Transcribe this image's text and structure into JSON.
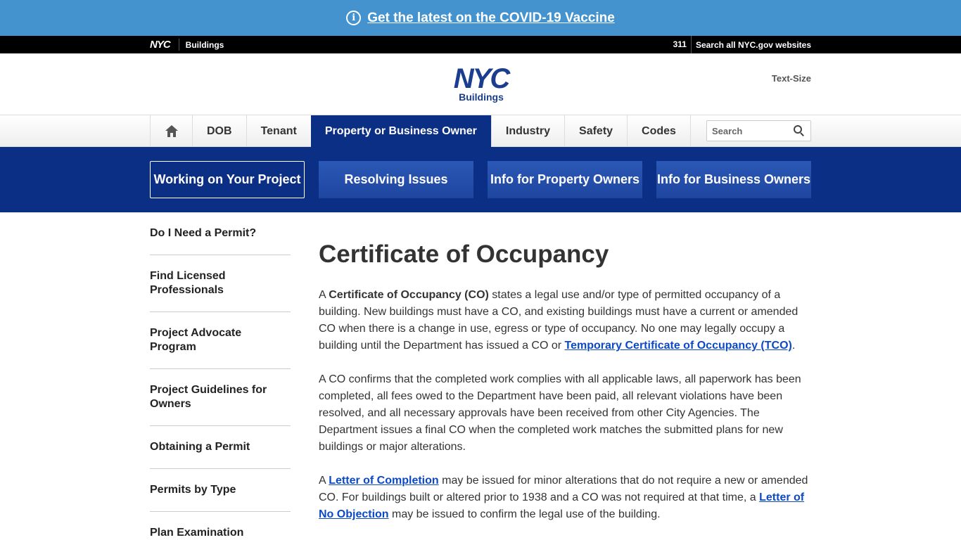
{
  "covid_banner": {
    "icon": "info-icon",
    "link_text": "Get the latest on the COVID-19 Vaccine"
  },
  "city_bar": {
    "logo": "NYC",
    "agency": "Buildings",
    "link_311": "311",
    "search_all": "Search all NYC.gov websites"
  },
  "header": {
    "logo_main": "NYC",
    "logo_sub": "Buildings",
    "text_size": "Text-Size"
  },
  "nav": {
    "items": [
      "DOB",
      "Tenant",
      "Property or Business Owner",
      "Industry",
      "Safety",
      "Codes"
    ],
    "active": "Property or Business Owner",
    "search_placeholder": "Search"
  },
  "subnav": {
    "buttons": [
      "Working on Your Project",
      "Resolving Issues",
      "Info for Property Owners",
      "Info for Business Owners"
    ],
    "active": "Working on Your Project"
  },
  "sidebar": {
    "items": [
      "Do I Need a Permit?",
      "Find Licensed Professionals",
      "Project Advocate Program",
      "Project Guidelines for Owners",
      "Obtaining a Permit",
      "Permits by Type",
      "Plan Examination"
    ]
  },
  "main": {
    "title": "Certificate of Occupancy",
    "p1": {
      "t1": "A ",
      "bold": "Certificate of Occupancy (CO)",
      "t2": " states a legal use and/or type of permitted occupancy of a building. New buildings must have a CO, and existing buildings must have a current or amended CO when there is a change in use, egress or type of occupancy. No one may legally occupy a building until the Department has issued a CO or ",
      "link": "Temporary Certificate of Occupancy (TCO)",
      "t3": "."
    },
    "p2": "A CO confirms that the completed work complies with all applicable laws, all paperwork has been completed, all fees owed to the Department have been paid, all relevant violations have been resolved, and all necessary approvals have been received from other City Agencies. The Department issues a final CO when the completed work matches the submitted plans for new buildings or major alterations.",
    "p3": {
      "t1": "A ",
      "link1": "Letter of Completion",
      "t2": " may be issued for minor alterations that do not require a new or amended CO. For buildings built or altered prior to 1938 and a CO was not required at that time, a ",
      "link2": "Letter of No Objection",
      "t3": " may be issued to confirm the legal use of the building."
    }
  },
  "colors": {
    "covid_bar": "#4493cf",
    "navy": "#0b2f84",
    "link": "#0d49c4"
  }
}
